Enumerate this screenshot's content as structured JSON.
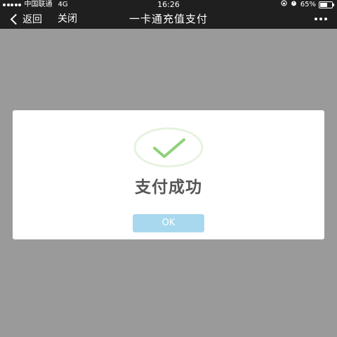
{
  "status_bar": {
    "carrier": "中国联通",
    "network": "4G",
    "time": "16:26",
    "battery_percent": "65%",
    "battery_level": 0.65,
    "icons": [
      "signal-dots-icon",
      "rotation-lock-icon",
      "alarm-icon",
      "battery-icon"
    ]
  },
  "nav_bar": {
    "back_label": "返回",
    "close_label": "关闭",
    "title": "一卡通充值支付",
    "more_icon": "more-dots-icon"
  },
  "dialog": {
    "icon": "checkmark-icon",
    "accent_color": "#8fd07a",
    "title": "支付成功",
    "ok_label": "OK",
    "ok_color": "#a8d8ee"
  },
  "colors": {
    "bar_background": "#1f1f1f",
    "overlay": "#9a9a9a"
  }
}
